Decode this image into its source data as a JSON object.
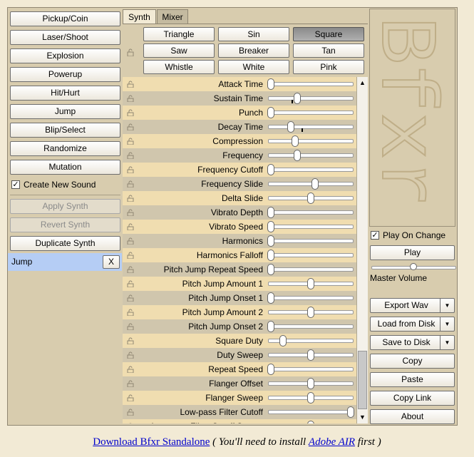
{
  "left_panel": {
    "generators": [
      "Pickup/Coin",
      "Laser/Shoot",
      "Explosion",
      "Powerup",
      "Hit/Hurt",
      "Jump",
      "Blip/Select",
      "Randomize",
      "Mutation"
    ],
    "create_new_sound": {
      "label": "Create New Sound",
      "checked": true
    },
    "apply_synth": "Apply Synth",
    "revert_synth": "Revert Synth",
    "duplicate_synth": "Duplicate Synth",
    "sound_list": [
      {
        "name": "Jump",
        "delete": "X"
      }
    ]
  },
  "tabs": [
    "Synth",
    "Mixer"
  ],
  "waveforms": {
    "items": [
      "Triangle",
      "Sin",
      "Square",
      "Saw",
      "Breaker",
      "Tan",
      "Whistle",
      "White",
      "Pink"
    ],
    "selected": "Square"
  },
  "params": [
    {
      "name": "Attack Time",
      "value": 0.0,
      "tick": null
    },
    {
      "name": "Sustain Time",
      "value": 0.33,
      "tick": 0.28
    },
    {
      "name": "Punch",
      "value": 0.0,
      "tick": null
    },
    {
      "name": "Decay Time",
      "value": 0.25,
      "tick": 0.4
    },
    {
      "name": "Compression",
      "value": 0.3,
      "tick": null
    },
    {
      "name": "Frequency",
      "value": 0.33,
      "tick": null
    },
    {
      "name": "Frequency Cutoff",
      "value": 0.0,
      "tick": null
    },
    {
      "name": "Frequency Slide",
      "value": 0.55,
      "tick": 0.55
    },
    {
      "name": "Delta Slide",
      "value": 0.5,
      "tick": null
    },
    {
      "name": "Vibrato Depth",
      "value": 0.0,
      "tick": null
    },
    {
      "name": "Vibrato Speed",
      "value": 0.0,
      "tick": null
    },
    {
      "name": "Harmonics",
      "value": 0.0,
      "tick": null
    },
    {
      "name": "Harmonics Falloff",
      "value": 0.0,
      "tick": null
    },
    {
      "name": "Pitch Jump Repeat Speed",
      "value": 0.0,
      "tick": null
    },
    {
      "name": "Pitch Jump Amount 1",
      "value": 0.5,
      "tick": null
    },
    {
      "name": "Pitch Jump Onset 1",
      "value": 0.0,
      "tick": null
    },
    {
      "name": "Pitch Jump Amount 2",
      "value": 0.5,
      "tick": null
    },
    {
      "name": "Pitch Jump Onset 2",
      "value": 0.0,
      "tick": null
    },
    {
      "name": "Square Duty",
      "value": 0.15,
      "tick": null
    },
    {
      "name": "Duty Sweep",
      "value": 0.5,
      "tick": null
    },
    {
      "name": "Repeat Speed",
      "value": 0.0,
      "tick": null
    },
    {
      "name": "Flanger Offset",
      "value": 0.5,
      "tick": null
    },
    {
      "name": "Flanger Sweep",
      "value": 0.5,
      "tick": null
    },
    {
      "name": "Low-pass Filter Cutoff",
      "value": 1.0,
      "tick": null
    },
    {
      "name": "Low-pass Filter Cutoff Sweep",
      "value": 0.5,
      "tick": null
    }
  ],
  "right_panel": {
    "logo": "Bfxr",
    "play_on_change": {
      "label": "Play On Change",
      "checked": true
    },
    "play": "Play",
    "master_volume": {
      "label": "Master Volume",
      "value": 0.5
    },
    "export_wav": "Export Wav",
    "load_from_disk": "Load from Disk",
    "save_to_disk": "Save to Disk",
    "copy": "Copy",
    "paste": "Paste",
    "copy_link": "Copy Link",
    "about": "About"
  },
  "footer": {
    "link1": "Download Bfxr Standalone",
    "text1": "( You'll need to install",
    "link2": "Adobe AIR",
    "text2": "first )"
  }
}
